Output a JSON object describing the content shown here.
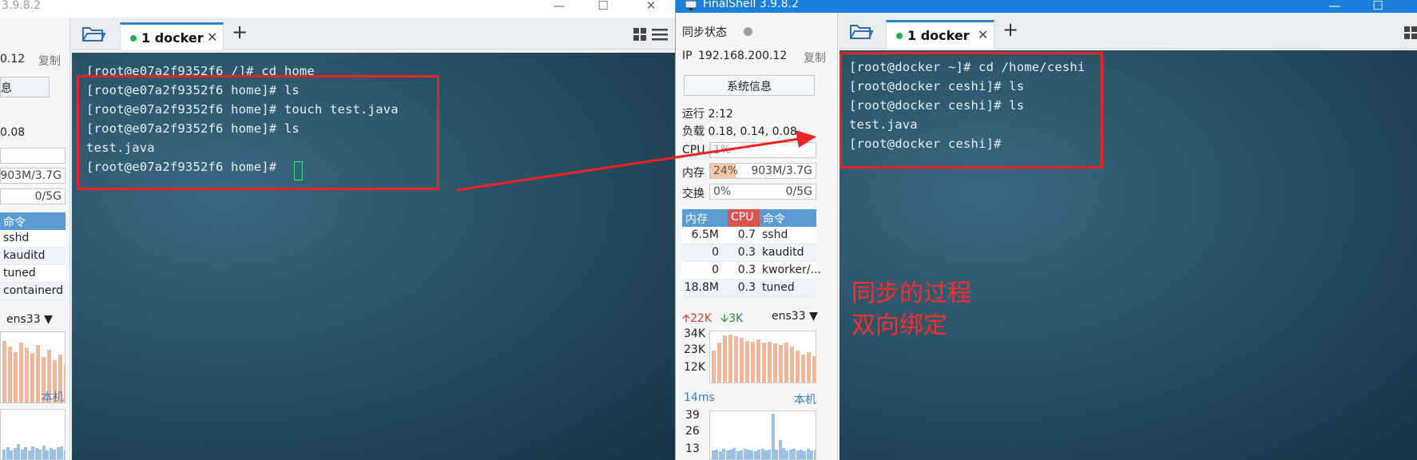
{
  "left_window": {
    "title": "3.9.8.2",
    "sidebar": {
      "ip_suffix": "0.12",
      "copy_label": "复制",
      "sysinfo_label": "息",
      "load_suffix": "0.08",
      "mem_value": "903M/3.7G",
      "swap_value": "0/5G",
      "proc_header_cmd": "命令",
      "processes": [
        "sshd",
        "kauditd",
        "tuned",
        "containerd"
      ],
      "net_interface": "ens33",
      "local_label": "本机"
    },
    "tab": {
      "label": "1 docker"
    },
    "terminal_lines": [
      "[root@e07a2f9352f6 /]# cd home",
      "[root@e07a2f9352f6 home]# ls",
      "[root@e07a2f9352f6 home]# touch test.java",
      "[root@e07a2f9352f6 home]# ls",
      "test.java",
      "[root@e07a2f9352f6 home]# "
    ]
  },
  "right_window": {
    "title": "FinalShell 3.9.8.2",
    "sidebar": {
      "sync_status": "同步状态",
      "ip_label": "IP",
      "ip_value": "192.168.200.12",
      "copy_label": "复制",
      "sysinfo_button": "系统信息",
      "uptime": "运行 2:12",
      "load": "负载 0.18, 0.14, 0.08",
      "cpu_label": "CPU",
      "cpu_value": "1%",
      "mem_label": "内存",
      "mem_percent": "24%",
      "mem_value": "903M/3.7G",
      "swap_label": "交换",
      "swap_percent": "0%",
      "swap_value": "0/5G",
      "proc_headers": [
        "内存",
        "CPU",
        "命令"
      ],
      "processes": [
        {
          "mem": "6.5M",
          "cpu": "0.7",
          "cmd": "sshd"
        },
        {
          "mem": "0",
          "cpu": "0.3",
          "cmd": "kauditd"
        },
        {
          "mem": "0",
          "cpu": "0.3",
          "cmd": "kworker/..."
        },
        {
          "mem": "18.8M",
          "cpu": "0.3",
          "cmd": "tuned"
        }
      ],
      "net_up": "22K",
      "net_down": "3K",
      "net_interface": "ens33",
      "net_ticks": [
        "34K",
        "23K",
        "12K"
      ],
      "ping": "14ms",
      "local_label": "本机",
      "ping_ticks": [
        "39",
        "26",
        "13"
      ]
    },
    "tab": {
      "label": "1 docker"
    },
    "terminal_lines": [
      "[root@docker ~]# cd /home/ceshi",
      "[root@docker ceshi]# ls",
      "[root@docker ceshi]# ls",
      "test.java",
      "[root@docker ceshi]#"
    ]
  },
  "annotation": {
    "line1": "同步的过程",
    "line2": "双向绑定",
    "color": "#ff2a2a"
  },
  "colors": {
    "terminal_bg": "#2a5469",
    "tab_accent": "#2f80d1",
    "status_dot": "#22b14c",
    "cpu_header": "#d9534f",
    "mem_header": "#5a9bd6"
  }
}
